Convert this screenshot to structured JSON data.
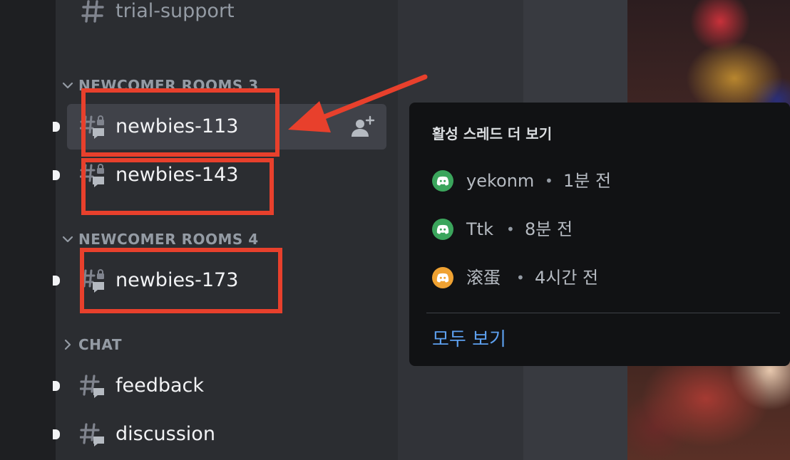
{
  "sidebar": {
    "top_channel": {
      "name": "trial-support",
      "icon": "hash-icon"
    },
    "categories": [
      {
        "label": "NEWCOMER ROOMS 3",
        "expanded": true
      },
      {
        "label": "NEWCOMER ROOMS 4",
        "expanded": true
      },
      {
        "label": "CHAT",
        "expanded": false
      }
    ],
    "channels": [
      {
        "name": "newbies-113",
        "icon": "locked-thread-icon",
        "selected": true,
        "action_icon": "add-member-icon"
      },
      {
        "name": "newbies-143",
        "icon": "locked-thread-icon"
      },
      {
        "name": "newbies-173",
        "icon": "locked-thread-icon"
      },
      {
        "name": "feedback",
        "icon": "hash-thread-icon"
      },
      {
        "name": "discussion",
        "icon": "hash-thread-icon"
      }
    ]
  },
  "popover": {
    "title": "활성 스레드 더 보기",
    "threads": [
      {
        "user": "yekonm",
        "time": "1분 전",
        "avatar_color": "#3ba55c"
      },
      {
        "user": "Ttk",
        "time": "8분 전",
        "avatar_color": "#3ba55c"
      },
      {
        "user": "滚蛋",
        "time": "4시간 전",
        "avatar_color": "#f0a232"
      }
    ],
    "view_all_label": "모두 보기"
  },
  "colors": {
    "annotation": "#e8402c",
    "link": "#5da0ef"
  }
}
